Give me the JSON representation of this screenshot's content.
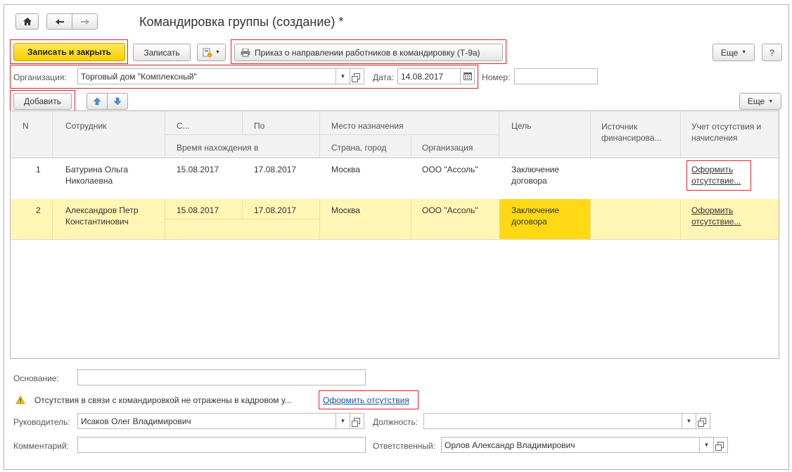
{
  "window": {
    "title": "Командировка группы (создание) *"
  },
  "nav": {
    "home_icon": "home-icon",
    "back_icon": "arrow-left-icon",
    "forward_icon": "arrow-right-icon"
  },
  "toolbar": {
    "save_close": "Записать и закрыть",
    "save": "Записать",
    "print_order": "Приказ о направлении работников в командировку (Т-9а)",
    "more": "Еще",
    "help": "?"
  },
  "org": {
    "label": "Организация:",
    "value": "Торговый дом \"Комплексный\""
  },
  "date": {
    "label": "Дата:",
    "value": "14.08.2017"
  },
  "number": {
    "label": "Номер:",
    "value": ""
  },
  "table_toolbar": {
    "add": "Добавить",
    "more": "Еще"
  },
  "table": {
    "headers": {
      "n": "N",
      "employee": "Сотрудник",
      "from": "С...",
      "to": "По",
      "stay_time": "Время нахождения в",
      "destination": "Место назначения",
      "country_city": "Страна, город",
      "organization": "Организация",
      "goal": "Цель",
      "funding_l1": "Источник",
      "funding_l2": "финансирова...",
      "absence_l1": "Учет отсутствия и",
      "absence_l2": "начисления"
    },
    "rows": [
      {
        "n": "1",
        "emp_l1": "Батурина Ольга",
        "emp_l2": "Николаевна",
        "from": "15.08.2017",
        "to": "17.08.2017",
        "city": "Москва",
        "org": "ООО \"Ассоль\"",
        "goal_l1": "Заключение",
        "goal_l2": "договора",
        "link_l1": "Оформить",
        "link_l2": "отсутствие..."
      },
      {
        "n": "2",
        "emp_l1": "Александров Петр",
        "emp_l2": "Константинович",
        "from": "15.08.2017",
        "to": "17.08.2017",
        "city": "Москва",
        "org": "ООО \"Ассоль\"",
        "goal_l1": "Заключение",
        "goal_l2": "договора",
        "link_l1": "Оформить",
        "link_l2": "отсутствие..."
      }
    ]
  },
  "basis": {
    "label": "Основание:",
    "value": ""
  },
  "warning": {
    "text": "Отсутствия в связи с командировкой не отражены в кадровом у...",
    "link": "Оформить отсутствия"
  },
  "manager": {
    "label": "Руководитель:",
    "value": "Исаков Олег Владимирович"
  },
  "position": {
    "label": "Должность:",
    "value": ""
  },
  "comment": {
    "label": "Комментарий:",
    "value": ""
  },
  "responsible": {
    "label": "Ответственный:",
    "value": "Орлов Александр Владимирович"
  },
  "colors": {
    "accent_yellow": "#f5cf00",
    "selected_row": "#fff5b4",
    "selected_cell": "#ffd914",
    "highlight_red": "#d9232d",
    "link": "#1e50a0"
  }
}
